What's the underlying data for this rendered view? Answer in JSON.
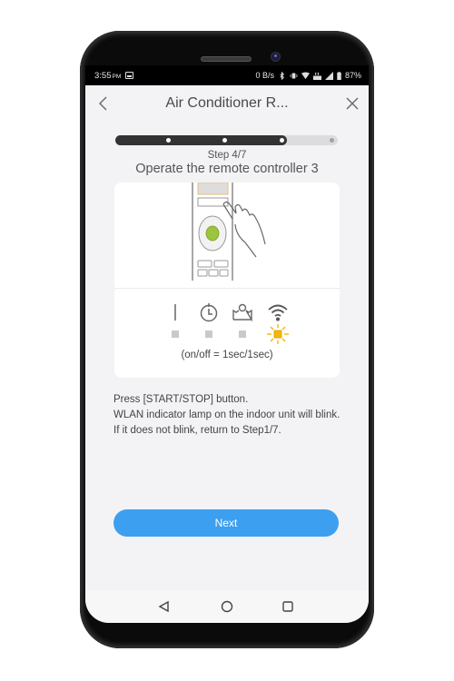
{
  "status_bar": {
    "time": "3:55",
    "ampm": "PM",
    "data_rate": "0 B/s",
    "battery": "87%",
    "icons": [
      "image-notification-icon",
      "bluetooth-icon",
      "vibrate-icon",
      "wifi-icon",
      "data-transfer-icon",
      "signal-icon",
      "battery-icon"
    ]
  },
  "header": {
    "title": "Air Conditioner R...",
    "back_icon": "chevron-left-icon",
    "close_icon": "close-icon"
  },
  "progress": {
    "current_step": 4,
    "total_steps": 7,
    "fill_fraction": 0.77,
    "dots": [
      {
        "state": "done"
      },
      {
        "state": "done"
      },
      {
        "state": "current"
      },
      {
        "state": "pending"
      }
    ]
  },
  "step": {
    "label": "Step 4/7",
    "title": "Operate the remote controller 3"
  },
  "card": {
    "illustration": "remote-controller-press-icon",
    "lamps": [
      {
        "name": "power-lamp",
        "state": "off"
      },
      {
        "name": "timer-lamp",
        "state": "off"
      },
      {
        "name": "vacation-lamp",
        "state": "off"
      },
      {
        "name": "wlan-lamp",
        "state": "blinking"
      }
    ],
    "lamp_colors": {
      "off": "#c9c9c9",
      "blinking": "#f5b800"
    },
    "blink_note": "(on/off = 1sec/1sec)"
  },
  "instructions": [
    "Press [START/STOP] button.",
    "WLAN indicator lamp on the indoor unit will blink.",
    "If it does not blink, return to Step1/7."
  ],
  "next_button": {
    "label": "Next",
    "color": "#3d9ff0"
  },
  "navbar": {
    "buttons": [
      "back-nav-icon",
      "home-nav-icon",
      "recents-nav-icon"
    ]
  }
}
